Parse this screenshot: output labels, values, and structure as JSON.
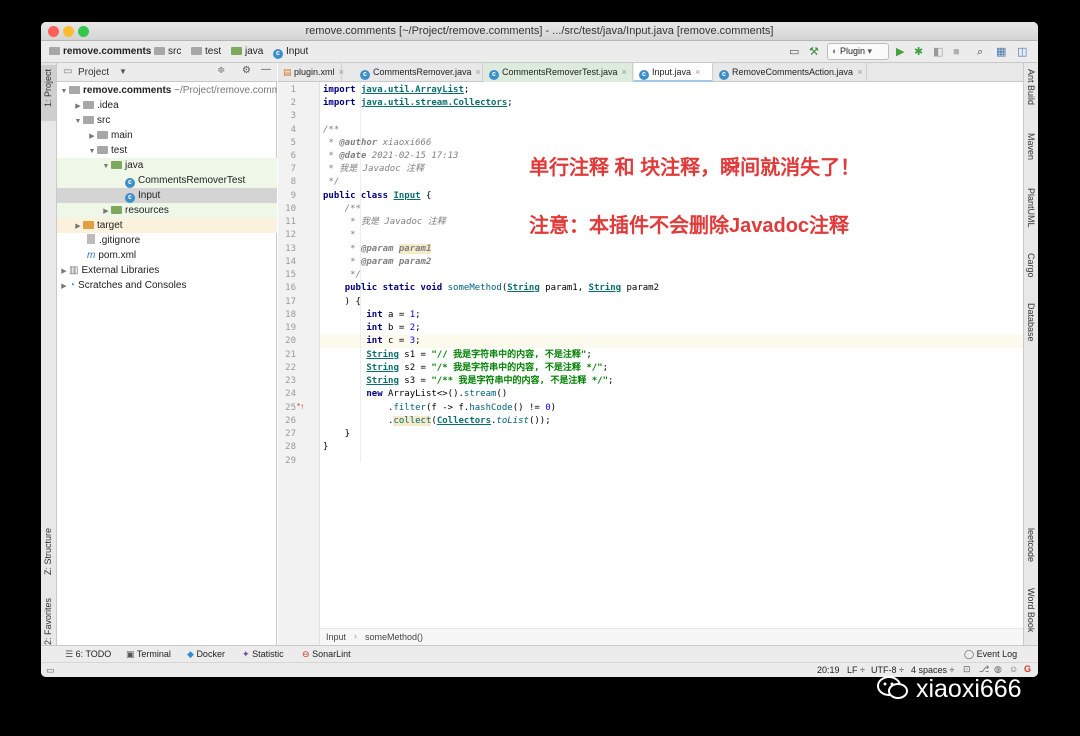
{
  "window": {
    "title": "remove.comments [~/Project/remove.comments] - .../src/test/java/Input.java [remove.comments]"
  },
  "nav": {
    "project": "remove.comments",
    "crumbs": [
      "src",
      "test",
      "java",
      "Input"
    ],
    "run_config": "Plugin"
  },
  "project_panel": {
    "title": "Project",
    "root_name": "remove.comments",
    "root_path": "~/Project/remove.comments",
    "items": [
      ".idea",
      "src",
      "main",
      "test",
      "java",
      "CommentsRemoverTest",
      "Input",
      "resources",
      "target",
      ".gitignore",
      "pom.xml",
      "External Libraries",
      "Scratches and Consoles"
    ]
  },
  "left_strip": {
    "project": "1: Project",
    "structure": "Z: Structure",
    "favorites": "2: Favorites"
  },
  "right_strip": [
    "Ant Build",
    "Maven",
    "PlantUML",
    "Cargo",
    "Database",
    "leetcode",
    "Word Book"
  ],
  "tabs": [
    "plugin.xml",
    "CommentsRemover.java",
    "CommentsRemoverTest.java",
    "Input.java",
    "RemoveCommentsAction.java"
  ],
  "editor": {
    "line_numbers": [
      "1",
      "2",
      "3",
      "4",
      "5",
      "6",
      "7",
      "8",
      "9",
      "10",
      "11",
      "12",
      "13",
      "14",
      "15",
      "16",
      "17",
      "18",
      "19",
      "20",
      "21",
      "22",
      "23",
      "24",
      "25",
      "26",
      "27",
      "28",
      "29"
    ],
    "code": {
      "import1_pkg": "java.util.ArrayList",
      "import2_pkg": "java.util.stream.Collectors",
      "author_tag": "@author",
      "author": "xiaoxi666",
      "date_tag": "@date",
      "date": "2021-02-15 17:13",
      "class_doc": "我是 Javadoc 注释",
      "class_name": "Input",
      "method_doc": "我是 Javadoc 注释",
      "param1_tag": "@param",
      "param1": "param1",
      "param2": "param2",
      "method_name": "someMethod",
      "s1": "\"// 我是字符串中的内容, 不是注释\"",
      "s2": "\"/* 我是字符串中的内容, 不是注释 */\"",
      "s3": "\"/** 我是字符串中的内容, 不是注释 */\""
    },
    "breadcrumb": [
      "Input",
      "someMethod()"
    ]
  },
  "annotation": {
    "line1": "单行注释 和 块注释，瞬间就消失了！",
    "line2": "注意：本插件不会删除Javadoc注释"
  },
  "tool_windows": [
    "6: TODO",
    "Terminal",
    "Docker",
    "Statistic",
    "SonarLint"
  ],
  "event_log": "Event Log",
  "status": {
    "position": "20:19",
    "line_sep": "LF",
    "encoding": "UTF-8",
    "indent": "4 spaces"
  },
  "watermark": "xiaoxi666"
}
